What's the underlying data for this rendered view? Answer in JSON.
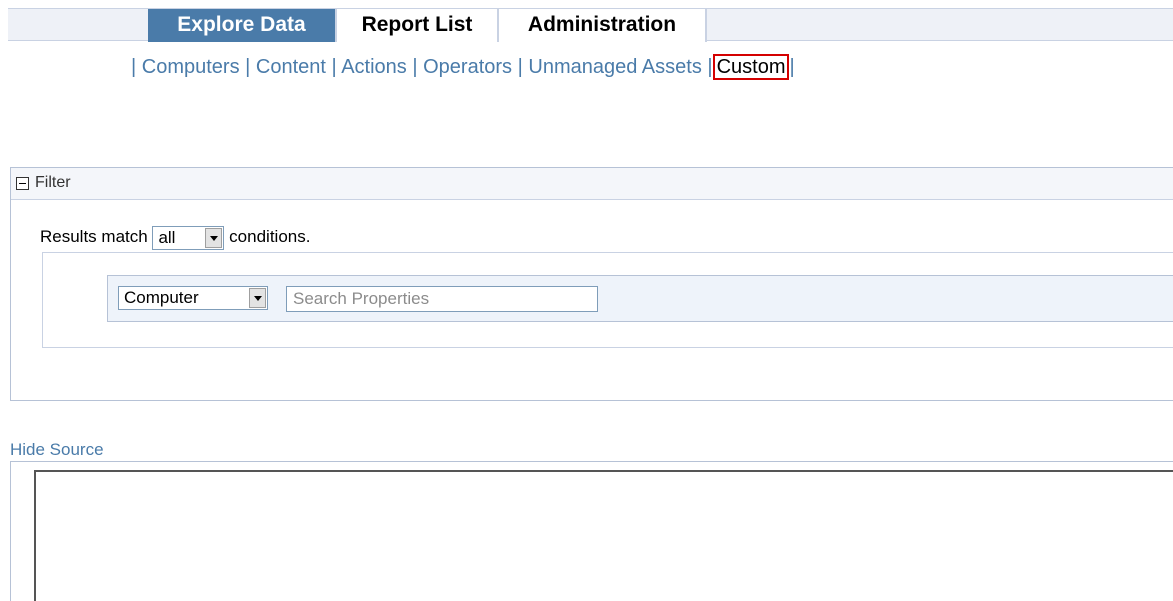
{
  "tabs": {
    "explore": "Explore Data",
    "report_list": "Report List",
    "administration": "Administration"
  },
  "subnav": {
    "computers": "Computers",
    "content": "Content",
    "actions": "Actions",
    "operators": "Operators",
    "unmanaged_assets": "Unmanaged Assets",
    "custom": "Custom",
    "separator": "|"
  },
  "filter": {
    "title": "Filter",
    "results_prefix": "Results match",
    "match_value": "all",
    "results_suffix": "conditions.",
    "object_type_value": "Computer",
    "search_placeholder": "Search Properties",
    "search_value": ""
  },
  "source": {
    "toggle_label": "Hide Source",
    "content": ""
  },
  "colors": {
    "accent": "#4a7ba9",
    "highlight_border": "#d40000"
  },
  "icons": {
    "collapse": "minus-box-icon",
    "dropdown": "chevron-down-icon"
  }
}
